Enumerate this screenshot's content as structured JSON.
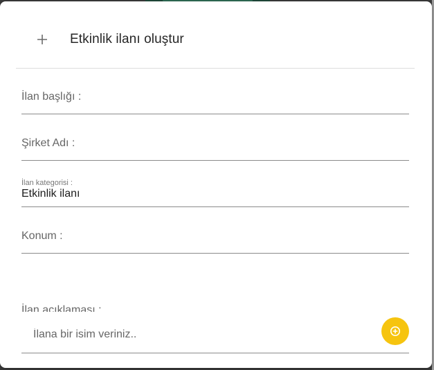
{
  "dialog": {
    "title": "Etkinlik ilanı oluştur",
    "header_icon": "plus-icon"
  },
  "form": {
    "fields": [
      {
        "label": "İlan başlığı :",
        "value": ""
      },
      {
        "label": "Şirket Adı :",
        "value": ""
      },
      {
        "label": "İlan kategorisi :",
        "value": "Etkinlik ilanı"
      },
      {
        "label": "Konum :",
        "value": ""
      }
    ],
    "description_label": "İlan açıklaması :",
    "name_input": {
      "placeholder": "İlana bir isim veriniz..",
      "value": ""
    },
    "add_button": {
      "icon": "add-circle-icon",
      "color": "#f6c40f"
    }
  }
}
